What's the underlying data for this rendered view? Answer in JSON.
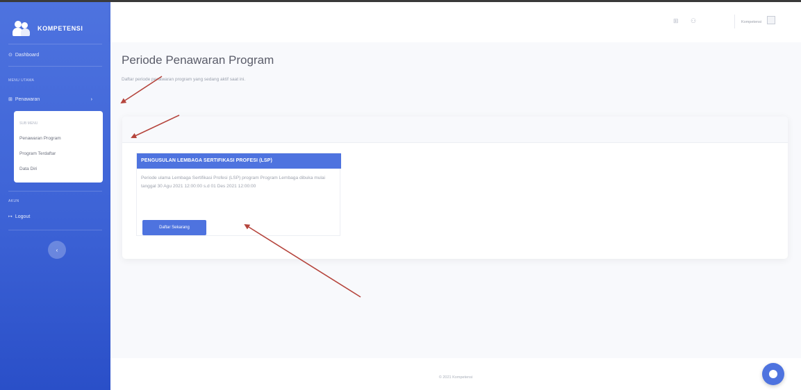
{
  "sidebar": {
    "brand": "KOMPETENSI",
    "dashboard": "Dashboard",
    "heading_main": "MENU UTAMA",
    "penawaran": "Penawaran",
    "submenu": {
      "heading": "SUB MENU",
      "items": [
        "Penawaran Program",
        "Program Terdaftar",
        "Data Diri"
      ]
    },
    "heading_other": "AKUN",
    "logout": "Logout"
  },
  "topbar": {
    "user_name": "Kompetensi"
  },
  "page": {
    "title": "Periode Penawaran Program",
    "subtitle": "Daftar periode penawaran program yang sedang aktif saat ini."
  },
  "card": {
    "title": "PENGUSULAN LEMBAGA SERTIFIKASI PROFESI (LSP)",
    "description": "Periode ulama Lembaga Sertifikasi Profesi (LSP) program Program Lembaga dibuka mulai tanggal 30 Agu 2021 12:00:00 s.d 01 Des 2021 12:00:00",
    "button_label": "Daftar Sekarang"
  },
  "footer": {
    "text": "© 2021 Kompetensi"
  },
  "colors": {
    "primary": "#4e73df",
    "annotation_arrow": "#b5443c"
  },
  "icons": [
    "people-icon",
    "dashboard-icon",
    "gift-icon",
    "chevron-right-icon",
    "logout-icon",
    "chevron-left-icon",
    "grid-icon",
    "users-icon",
    "avatar-image",
    "chat-icon"
  ]
}
